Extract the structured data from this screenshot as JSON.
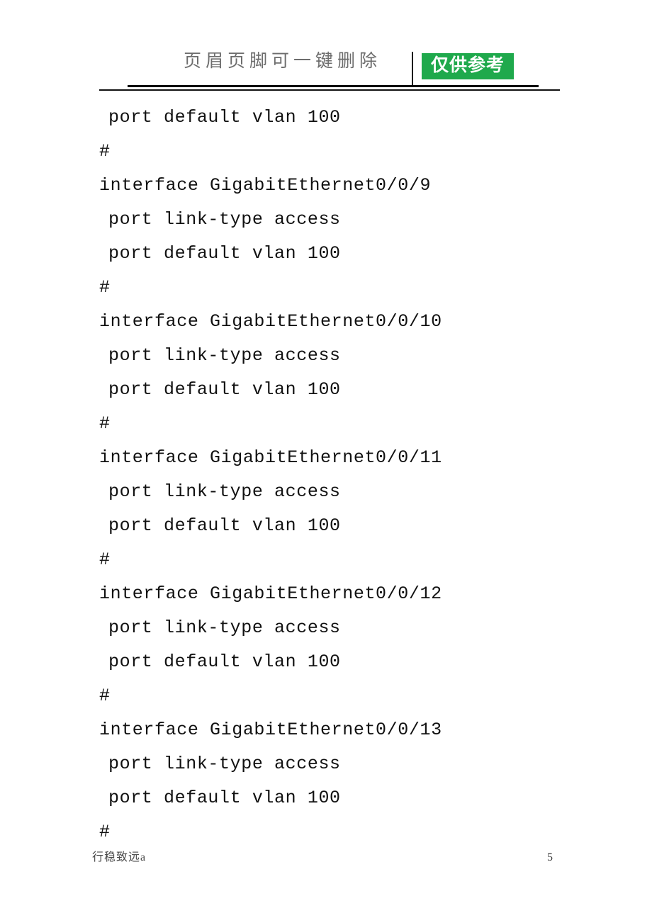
{
  "header": {
    "note": "页眉页脚可一键删除",
    "badge": "仅供参考",
    "badge_color": "#1fa94c",
    "divider_color": "#111111",
    "rule_color": "#000000"
  },
  "document": {
    "lines": [
      {
        "text": "port default vlan 100",
        "indent": true
      },
      {
        "text": "#",
        "indent": false
      },
      {
        "text": "interface GigabitEthernet0/0/9",
        "indent": false
      },
      {
        "text": "port link-type access",
        "indent": true
      },
      {
        "text": "port default vlan 100",
        "indent": true
      },
      {
        "text": "#",
        "indent": false
      },
      {
        "text": "interface GigabitEthernet0/0/10",
        "indent": false
      },
      {
        "text": "port link-type access",
        "indent": true
      },
      {
        "text": "port default vlan 100",
        "indent": true
      },
      {
        "text": "#",
        "indent": false
      },
      {
        "text": "interface GigabitEthernet0/0/11",
        "indent": false
      },
      {
        "text": "port link-type access",
        "indent": true
      },
      {
        "text": "port default vlan 100",
        "indent": true
      },
      {
        "text": "#",
        "indent": false
      },
      {
        "text": "interface GigabitEthernet0/0/12",
        "indent": false
      },
      {
        "text": "port link-type access",
        "indent": true
      },
      {
        "text": "port default vlan 100",
        "indent": true
      },
      {
        "text": "#",
        "indent": false
      },
      {
        "text": "interface GigabitEthernet0/0/13",
        "indent": false
      },
      {
        "text": "port link-type access",
        "indent": true
      },
      {
        "text": "port default vlan 100",
        "indent": true
      },
      {
        "text": "#",
        "indent": false
      }
    ]
  },
  "footer": {
    "watermark": "行稳致远a",
    "page_number": "5"
  }
}
